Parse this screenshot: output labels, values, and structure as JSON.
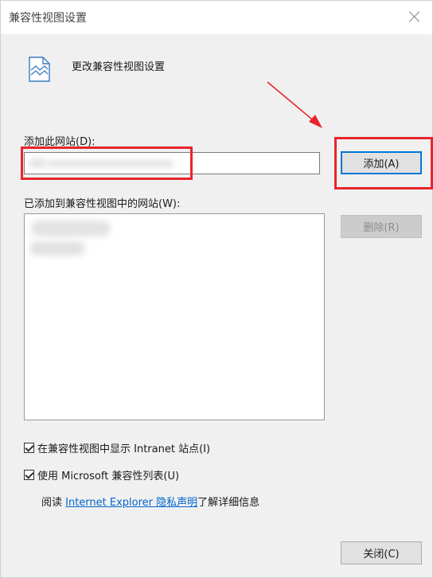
{
  "window": {
    "title": "兼容性视图设置"
  },
  "header": {
    "icon": "document-icon",
    "title": "更改兼容性视图设置"
  },
  "add_site": {
    "label": "添加此网站(D):",
    "input_value": "",
    "add_button": "添加(A)"
  },
  "sites_list": {
    "label": "已添加到兼容性视图中的网站(W):",
    "remove_button": "删除(R)"
  },
  "options": {
    "show_intranet": {
      "label": "在兼容性视图中显示 Intranet 站点(I)",
      "checked": true
    },
    "use_microsoft_list": {
      "label": "使用 Microsoft 兼容性列表(U)",
      "checked": true
    }
  },
  "read_more": {
    "prefix": "阅读 ",
    "link_text": "Internet Explorer 隐私声明",
    "suffix": "了解详细信息"
  },
  "footer": {
    "close_button": "关闭(C)"
  },
  "annotation_color": "#e8242c"
}
